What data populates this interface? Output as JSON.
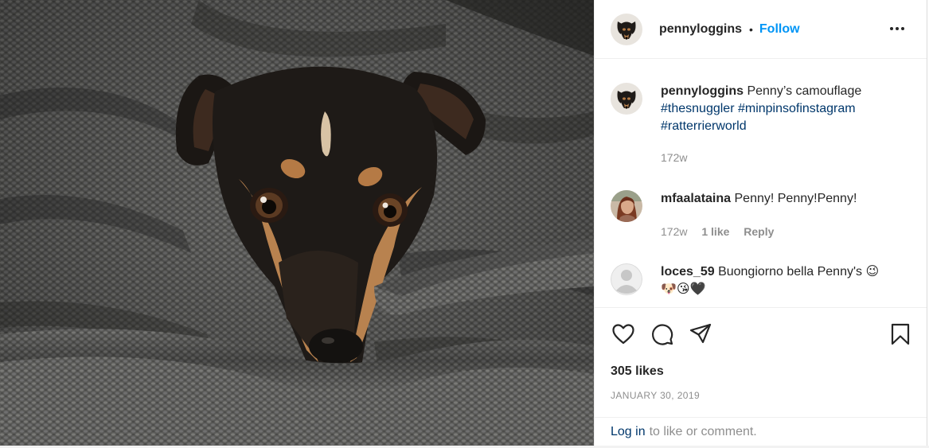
{
  "post": {
    "author": {
      "username": "pennyloggins",
      "separator": "•",
      "follow_label": "Follow"
    },
    "caption": {
      "username": "pennyloggins",
      "text": "Penny’s camouflage",
      "hashtags": [
        "#thesnuggler",
        "#minpinsofinstagram",
        "#ratterrierworld"
      ],
      "time": "172w"
    },
    "comments": [
      {
        "username": "mfaalataina",
        "text": "Penny! Penny!Penny!",
        "time": "172w",
        "likes": "1 like",
        "reply": "Reply"
      },
      {
        "username": "loces_59",
        "text": "Buongiorno bella Penny's",
        "emoji_line1": "😉",
        "emoji_line2": "🐶😘🖤"
      }
    ],
    "likes": "305 likes",
    "date": "JANUARY 30, 2019",
    "login": {
      "link": "Log in",
      "text": "to like or comment."
    },
    "icons": {
      "like": "heart-icon",
      "comment": "comment-bubble-icon",
      "share": "paper-plane-icon",
      "save": "bookmark-icon",
      "more": "more-options-icon"
    },
    "colors": {
      "follow": "#0095f6",
      "hashtag": "#00376b",
      "muted": "#8e8e8e",
      "text": "#262626"
    }
  }
}
